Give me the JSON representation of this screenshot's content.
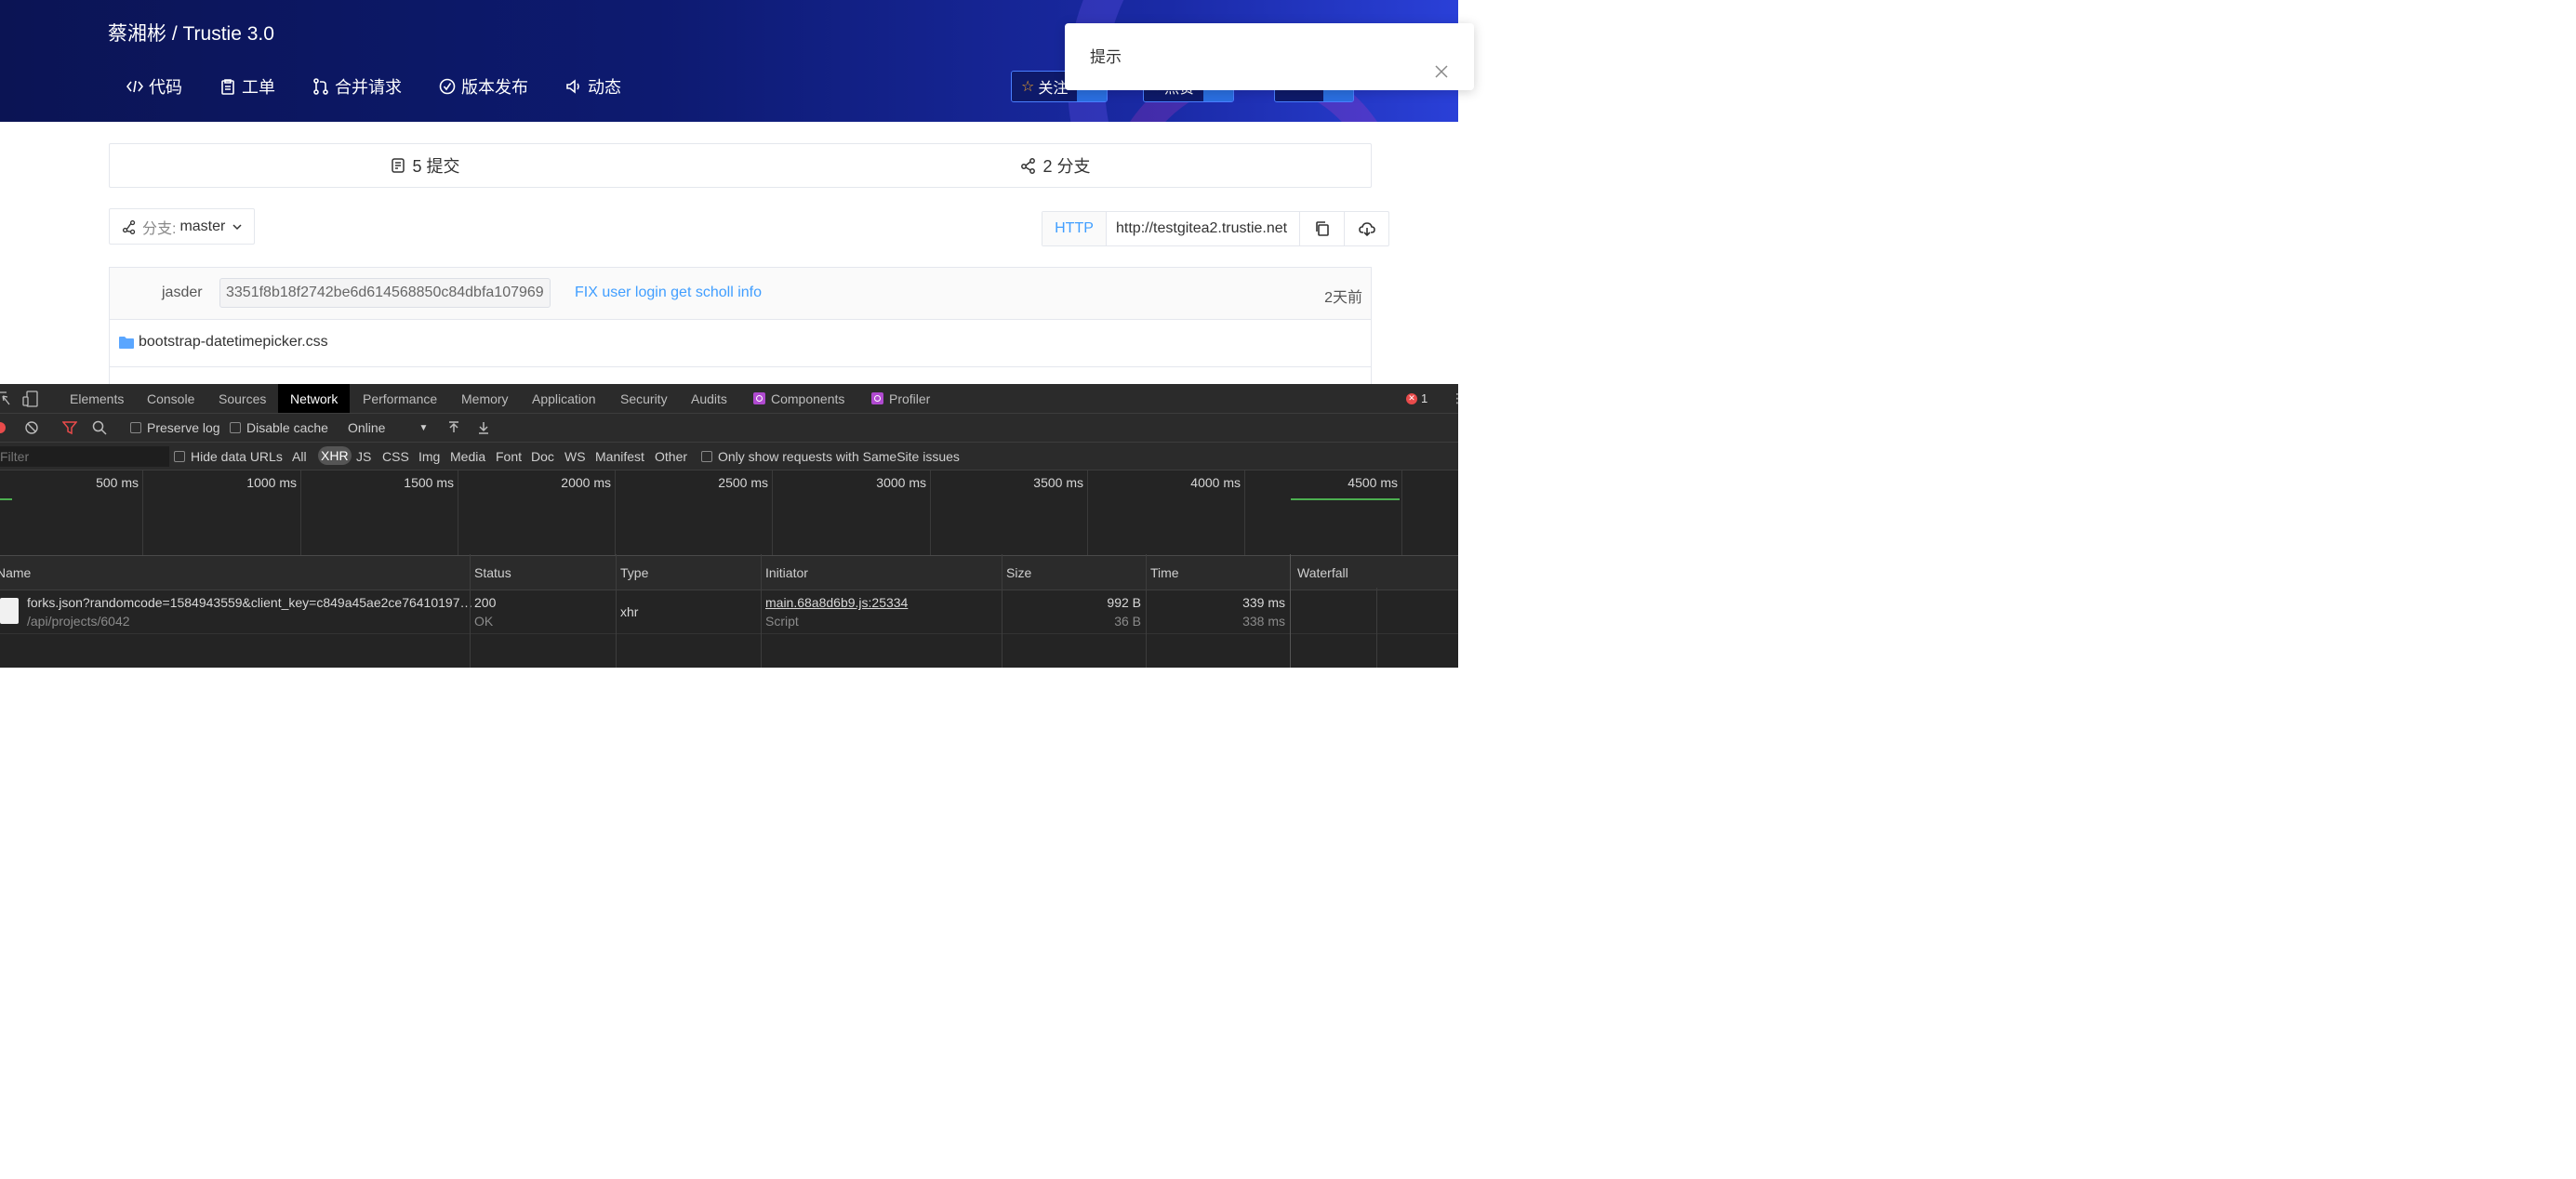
{
  "header": {
    "repo_title": "蔡湘彬 / Trustie 3.0",
    "nav": [
      {
        "label": "代码",
        "icon": "code-icon"
      },
      {
        "label": "工单",
        "icon": "clipboard-icon"
      },
      {
        "label": "合并请求",
        "icon": "merge-icon"
      },
      {
        "label": "版本发布",
        "icon": "check-circle-icon"
      },
      {
        "label": "动态",
        "icon": "speaker-icon"
      }
    ],
    "watch_label": "关注",
    "star_label": "点赞",
    "fork_label": "Fork"
  },
  "toast": {
    "title": "提示"
  },
  "stats": {
    "commits": "5 提交",
    "branches": "2 分支"
  },
  "branch": {
    "prefix": "分支:",
    "value": "master"
  },
  "clone": {
    "protocol": "HTTP",
    "url": "http://testgitea2.trustie.net"
  },
  "commit": {
    "author": "jasder",
    "sha": "3351f8b18f2742be6d614568850c84dbfa107969",
    "message": "FIX user login get scholl info",
    "time": "2天前"
  },
  "files": [
    {
      "name": "bootstrap-datetimepicker.css"
    }
  ],
  "devtools": {
    "tabs": [
      "Elements",
      "Console",
      "Sources",
      "Network",
      "Performance",
      "Memory",
      "Application",
      "Security",
      "Audits",
      "Components",
      "Profiler"
    ],
    "error_count": "1",
    "toolbar": {
      "preserve_log": "Preserve log",
      "disable_cache": "Disable cache",
      "throttle": "Online"
    },
    "filter": {
      "placeholder": "Filter",
      "hide_data_urls": "Hide data URLs",
      "types": [
        "All",
        "XHR",
        "JS",
        "CSS",
        "Img",
        "Media",
        "Font",
        "Doc",
        "WS",
        "Manifest",
        "Other"
      ],
      "samesite": "Only show requests with SameSite issues"
    },
    "timeline_ticks": [
      "500 ms",
      "1000 ms",
      "1500 ms",
      "2000 ms",
      "2500 ms",
      "3000 ms",
      "3500 ms",
      "4000 ms",
      "4500 ms"
    ],
    "columns": [
      "Name",
      "Status",
      "Type",
      "Initiator",
      "Size",
      "Time",
      "Waterfall"
    ],
    "rows": [
      {
        "name": "forks.json?randomcode=1584943559&client_key=c849a45ae2ce76410197…",
        "path": "/api/projects/6042",
        "status": "200",
        "status_text": "OK",
        "type": "xhr",
        "initiator": "main.68a8d6b9.js:25334",
        "initiator_type": "Script",
        "size": "992 B",
        "size_resource": "36 B",
        "time": "339 ms",
        "time_latency": "338 ms"
      }
    ]
  }
}
